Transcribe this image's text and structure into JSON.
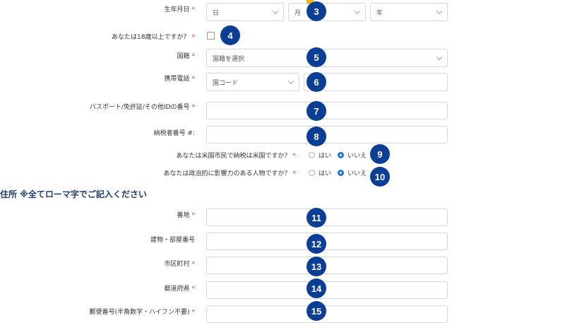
{
  "form": {
    "dob": {
      "label": "生年月日",
      "req": "*",
      "day": "日",
      "month": "月",
      "year": "年"
    },
    "over18": {
      "label": "あなたは18歳以上ですか？",
      "req": "*"
    },
    "nationality": {
      "label": "国籍",
      "req": "*",
      "value": "国籍を選択"
    },
    "phone": {
      "label": "携帯電話",
      "req": "*",
      "code": "国コード",
      "number": ""
    },
    "passport": {
      "label": "パスポート/免許証/その他IDの番号",
      "req": "*",
      "value": ""
    },
    "tax": {
      "label": "納税者番号 #:",
      "value": ""
    },
    "us_citizen": {
      "label": "あなたは米国市民で納税は米国ですか？",
      "req": "*",
      "yes": "はい",
      "no": "いいえ"
    },
    "pep": {
      "label": "あなたは政治的に影響力のある人物ですか？",
      "req": "*",
      "yes": "はい",
      "no": "いいえ"
    }
  },
  "address": {
    "title": "住所 ※全てローマ字でご記入ください",
    "street": {
      "label": "番地",
      "req": "*",
      "value": ""
    },
    "building": {
      "label": "建物・部屋番号",
      "value": ""
    },
    "city": {
      "label": "市区町村",
      "req": "*",
      "value": ""
    },
    "prefecture": {
      "label": "都道府県",
      "req": "*",
      "value": ""
    },
    "postal": {
      "label": "郵便番号(半角数字・ハイフン不要)",
      "req": "*",
      "value": ""
    }
  },
  "badges": [
    "3",
    "4",
    "5",
    "6",
    "7",
    "8",
    "9",
    "10",
    "11",
    "12",
    "13",
    "14",
    "15"
  ]
}
